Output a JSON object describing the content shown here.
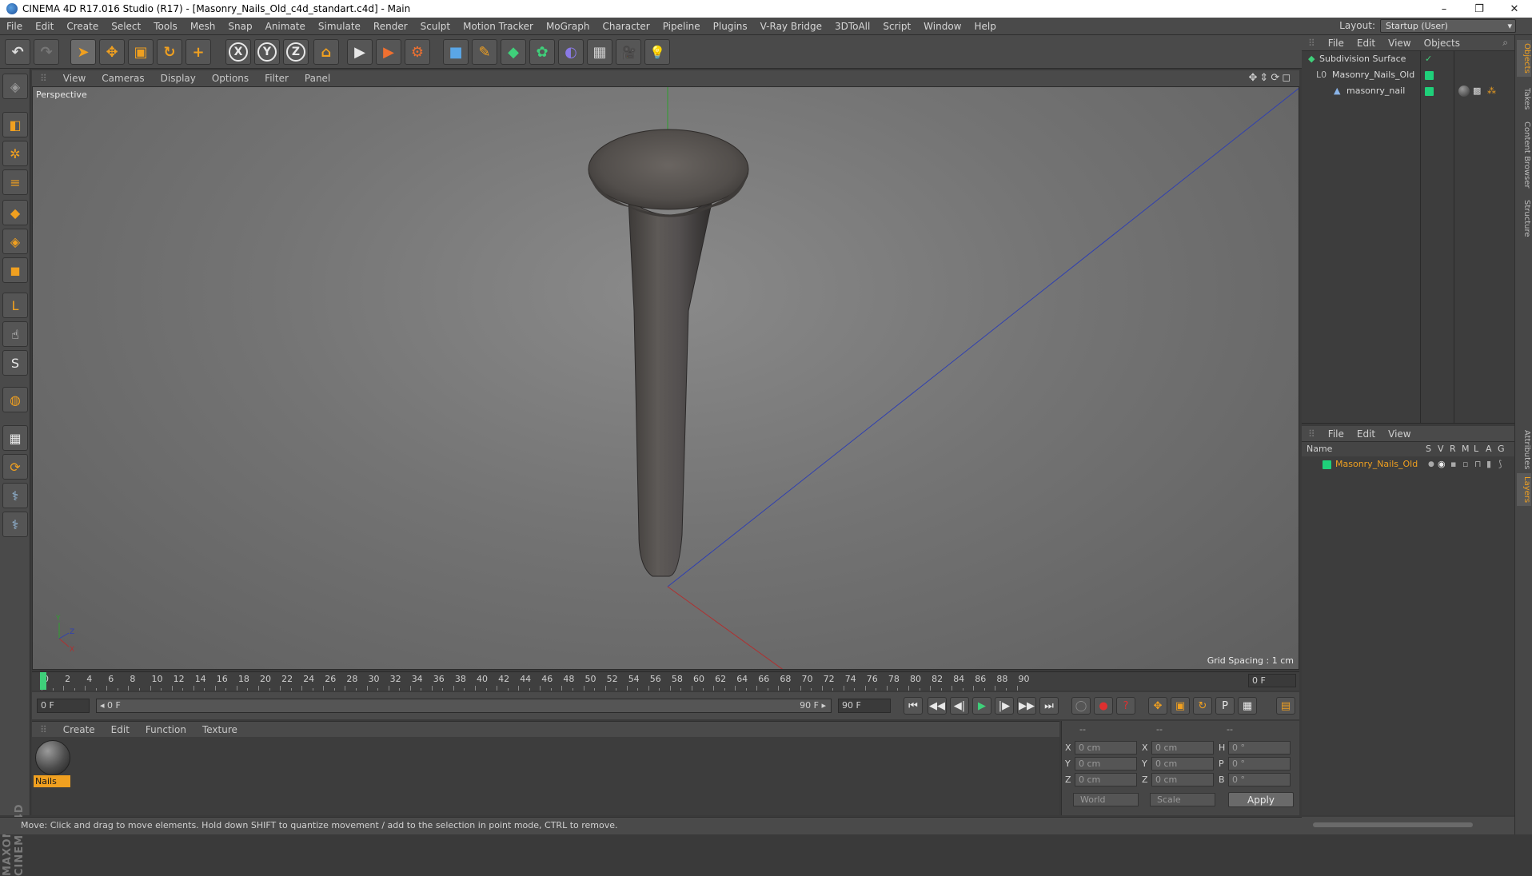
{
  "window": {
    "title": "CINEMA 4D R17.016 Studio (R17) - [Masonry_Nails_Old_c4d_standart.c4d] - Main",
    "minimize": "–",
    "restore": "❐",
    "close": "✕"
  },
  "menu": [
    "File",
    "Edit",
    "Create",
    "Select",
    "Tools",
    "Mesh",
    "Snap",
    "Animate",
    "Simulate",
    "Render",
    "Sculpt",
    "Motion Tracker",
    "MoGraph",
    "Character",
    "Pipeline",
    "Plugins",
    "V-Ray Bridge",
    "3DToAll",
    "Script",
    "Window",
    "Help"
  ],
  "layout": {
    "label": "Layout:",
    "value": "Startup (User)"
  },
  "toolbar": {
    "undo": "↶",
    "redo": "↷",
    "select": "➤",
    "move": "✥",
    "scale": "▣",
    "rotate": "↻",
    "transform": "+",
    "x": "X",
    "y": "Y",
    "z": "Z",
    "coord": "⌂",
    "render_view": "▶",
    "render_pic": "▶",
    "render_settings": "⚙",
    "cube": "■",
    "pen": "✎",
    "subdiv": "◆",
    "cloner": "✿",
    "deformer": "◐",
    "floor": "▦",
    "camera": "🎥",
    "light": "💡"
  },
  "left_tools": [
    "◈",
    "◧",
    "✲",
    "≡",
    "◆",
    "◈",
    "◼",
    "L",
    "☝",
    "S",
    "◍",
    "▦",
    "⟳",
    "⚕",
    "⚕"
  ],
  "viewport": {
    "menu": [
      "View",
      "Cameras",
      "Display",
      "Options",
      "Filter",
      "Panel"
    ],
    "nav_icons": "✥⇕⟳◻",
    "label": "Perspective",
    "grid_spacing": "Grid Spacing : 1 cm",
    "axis_y": "Y",
    "axis_z": "Z",
    "axis_x": "X"
  },
  "timeline": {
    "ticks": [
      "0",
      "2",
      "4",
      "6",
      "8",
      "10",
      "12",
      "14",
      "16",
      "18",
      "20",
      "22",
      "24",
      "26",
      "28",
      "30",
      "32",
      "34",
      "36",
      "38",
      "40",
      "42",
      "44",
      "46",
      "48",
      "50",
      "52",
      "54",
      "56",
      "58",
      "60",
      "62",
      "64",
      "66",
      "68",
      "70",
      "72",
      "74",
      "76",
      "78",
      "80",
      "82",
      "84",
      "86",
      "88",
      "90"
    ],
    "current_frame": "0 F"
  },
  "transport": {
    "start_field": "0 F",
    "range_start": "◂ 0 F",
    "range_end": "90 F ▸",
    "end_field": "90 F",
    "buttons": [
      "⏮",
      "◀◀",
      "◀|",
      "▶",
      "|▶",
      "▶▶",
      "⏭"
    ],
    "key_buttons": [
      "◯",
      "●",
      "?",
      "✥",
      "▣",
      "↻",
      "P",
      "▦",
      "▤"
    ]
  },
  "material_manager": {
    "menu": [
      "Create",
      "Edit",
      "Function",
      "Texture"
    ],
    "material_name": "Nails"
  },
  "coordinates": {
    "headers": [
      "--",
      "--",
      "--"
    ],
    "rows": [
      {
        "a": "X",
        "av": "0 cm",
        "b": "X",
        "bv": "0 cm",
        "c": "H",
        "cv": "0 °"
      },
      {
        "a": "Y",
        "av": "0 cm",
        "b": "Y",
        "bv": "0 cm",
        "c": "P",
        "cv": "0 °"
      },
      {
        "a": "Z",
        "av": "0 cm",
        "b": "Z",
        "bv": "0 cm",
        "c": "B",
        "cv": "0 °"
      }
    ],
    "space": "World",
    "mode": "Scale",
    "apply": "Apply"
  },
  "status": "Move: Click and drag to move elements. Hold down SHIFT to quantize movement / add to the selection in point mode, CTRL to remove.",
  "object_manager": {
    "menu": [
      "File",
      "Edit",
      "View",
      "Objects"
    ],
    "objects": [
      {
        "name": "Subdivision Surface",
        "indent": 0
      },
      {
        "name": "Masonry_Nails_Old",
        "indent": 1
      },
      {
        "name": "masonry_nail",
        "indent": 2
      }
    ]
  },
  "layer_manager": {
    "menu": [
      "File",
      "Edit",
      "View"
    ],
    "columns": [
      "Name",
      "S",
      "V",
      "R",
      "M",
      "L",
      "A",
      "G"
    ],
    "layers": [
      {
        "name": "Masonry_Nails_Old",
        "color": "#1fd07a"
      }
    ]
  },
  "right_tabs": [
    "Objects",
    "Takes",
    "Content Browser",
    "Structure",
    "Attributes",
    "Layers"
  ],
  "colors": {
    "accent": "#f0a020",
    "layer_green": "#1fd07a",
    "axis_x": "#c03030",
    "axis_y": "#30b030",
    "axis_z": "#3040c0"
  }
}
